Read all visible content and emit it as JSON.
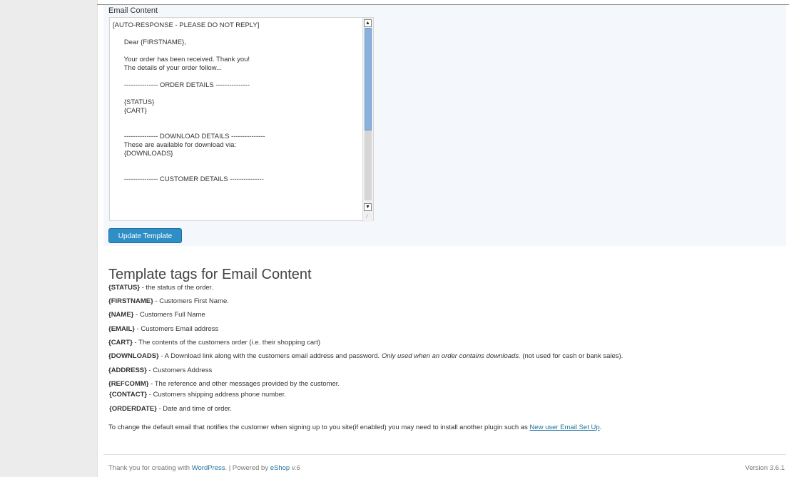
{
  "email_content": {
    "label": "Email Content",
    "value": "[AUTO-RESPONSE - PLEASE DO NOT REPLY]\n\n      Dear {FIRSTNAME},\n\n      Your order has been received. Thank you!\n      The details of your order follow...\n\n      --------------- ORDER DETAILS ---------------\n\n      {STATUS}\n      {CART}\n\n\n      --------------- DOWNLOAD DETAILS ---------------\n      These are available for download via:\n      {DOWNLOADS}\n\n\n      --------------- CUSTOMER DETAILS ---------------"
  },
  "buttons": {
    "update_template": "Update Template"
  },
  "tags_section": {
    "heading": "Template tags for Email Content",
    "tags": [
      {
        "tag": "{STATUS}",
        "desc": " - the status of the order."
      },
      {
        "tag": "{FIRSTNAME}",
        "desc": " - Customers First Name."
      },
      {
        "tag": "{NAME}",
        "desc": " - Customers Full Name"
      },
      {
        "tag": "{EMAIL}",
        "desc": " - Customers Email address"
      },
      {
        "tag": "{CART}",
        "desc": " - The contents of the customers order (i.e. their shopping cart)"
      },
      {
        "tag": "{DOWNLOADS}",
        "desc": " - A Download link along with the customers email address and password. ",
        "italic": "Only used when an order contains downloads.",
        "after": " (not used for cash or bank sales)."
      },
      {
        "tag": "{ADDRESS}",
        "desc": " - Customers Address"
      },
      {
        "tag": "{REFCOMM}",
        "desc": " - The reference and other messages provided by the customer."
      },
      {
        "tag": "{CONTACT}",
        "desc": " - Customers shipping address phone number."
      },
      {
        "tag": "{ORDERDATE}",
        "desc": " - Date and time of order."
      }
    ]
  },
  "info": {
    "text": "To change the default email that notifies the customer when signing up to you site(if enabled) you may need to install another plugin such as ",
    "link": "New user Email Set Up",
    "end": "."
  },
  "footer": {
    "thanks": "Thank you for creating with ",
    "wordpress": "WordPress",
    "separator": ". | Powered by ",
    "eshop": "eShop",
    "eshop_version": "v.6",
    "version": "Version 3.6.1"
  },
  "colors": {
    "accent": "#2e8ec6",
    "link": "#21759b",
    "panel": "#f4f8fc",
    "sidebar": "#ececec"
  },
  "icons": {
    "scroll_up": "arrow-up-icon",
    "scroll_down": "arrow-down-icon",
    "resize": "resize-grip-icon"
  }
}
